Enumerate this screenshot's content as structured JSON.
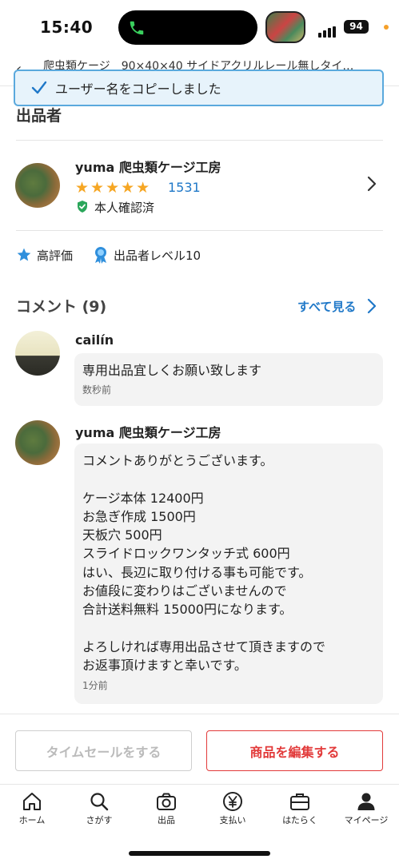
{
  "status_bar": {
    "time": "15:40",
    "battery": "94"
  },
  "nav": {
    "back_icon": "chevron-left-icon",
    "title": "爬虫類ケージ　90×40×40 サイドアクリルレール無しタイ…"
  },
  "toast": {
    "text": "ユーザー名をコピーしました",
    "accent": "#5aa9dd"
  },
  "seller_section": {
    "title": "出品者",
    "name": "yuma 爬虫類ケージ工房",
    "stars": "★★★★★",
    "rating_count": "1531",
    "verified": "本人確認済",
    "badges": [
      {
        "icon": "star-icon",
        "label": "高評価"
      },
      {
        "icon": "medal-icon",
        "label": "出品者レベル10"
      }
    ]
  },
  "comments": {
    "title": "コメント (9)",
    "see_all": "すべて見る",
    "items": [
      {
        "user": "cailín",
        "text": "専用出品宜しくお願い致します",
        "time": "数秒前"
      },
      {
        "user": "yuma 爬虫類ケージ工房",
        "text": "コメントありがとうございます。\n\nケージ本体 12400円\nお急ぎ作成 1500円\n天板穴 500円\nスライドロックワンタッチ式 600円\nはい、長辺に取り付ける事も可能です。\nお値段に変わりはございませんので\n合計送料無料 15000円になります。\n\nよろしければ専用出品させて頂きますので\nお返事頂けますと幸いです。",
        "time": "1分前"
      }
    ]
  },
  "actions": {
    "timesale": "タイムセールをする",
    "edit": "商品を編集する"
  },
  "tabs": [
    {
      "icon": "home-icon",
      "label": "ホーム"
    },
    {
      "icon": "search-icon",
      "label": "さがす"
    },
    {
      "icon": "camera-icon",
      "label": "出品"
    },
    {
      "icon": "yen-icon",
      "label": "支払い"
    },
    {
      "icon": "briefcase-icon",
      "label": "はたらく"
    },
    {
      "icon": "person-icon",
      "label": "マイページ"
    }
  ],
  "colors": {
    "link_blue": "#1f78c8",
    "star_orange": "#f6a623",
    "danger_red": "#e23a3a",
    "verified_green": "#2aa65a"
  }
}
